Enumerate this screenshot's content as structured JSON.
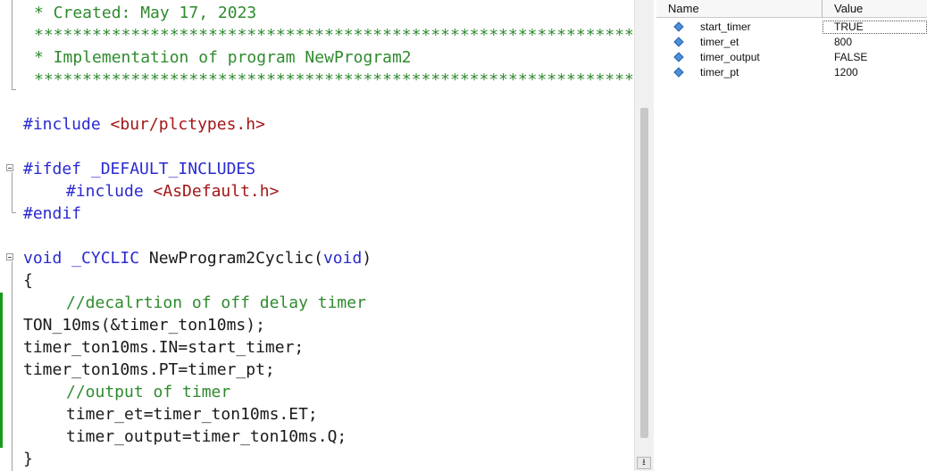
{
  "editor": {
    "lines": {
      "l1": "* Created: May 17, 2023",
      "l2": "******************************************************************",
      "l3": "* Implementation of program NewProgram2",
      "l4": "******************************************************************",
      "l6_kw": "#include",
      "l6_str": "<bur/plctypes.h>",
      "l8": "#ifdef _DEFAULT_INCLUDES",
      "l9_kw": "#include",
      "l9_str": "<AsDefault.h>",
      "l10": "#endif",
      "l12_kw1": "void _CYCLIC",
      "l12_name": "NewProgram2Cyclic(",
      "l12_kw2": "void",
      "l12_close": ")",
      "l13": "{",
      "l14": "//decalrtion of off delay timer",
      "l15": "TON_10ms(&timer_ton10ms);",
      "l16": "timer_ton10ms.IN=start_timer;",
      "l17": "timer_ton10ms.PT=timer_pt;",
      "l18": "//output of timer",
      "l19": "timer_et=timer_ton10ms.ET;",
      "l20": "timer_output=timer_ton10ms.Q;",
      "l21": "}"
    }
  },
  "scrollbar": {
    "bottom_button_glyph": "⭳"
  },
  "watch": {
    "header": {
      "name": "Name",
      "value": "Value"
    },
    "rows": [
      {
        "name": "start_timer",
        "value": "TRUE"
      },
      {
        "name": "timer_et",
        "value": "800"
      },
      {
        "name": "timer_output",
        "value": "FALSE"
      },
      {
        "name": "timer_pt",
        "value": "1200"
      }
    ],
    "icon": "variable-diamond-icon",
    "icon_color": "#4a8fd8"
  },
  "colors": {
    "comment": "#2e8b2e",
    "keyword": "#2a2ad0",
    "string": "#a31515",
    "change_marker": "#1a9a1a"
  }
}
